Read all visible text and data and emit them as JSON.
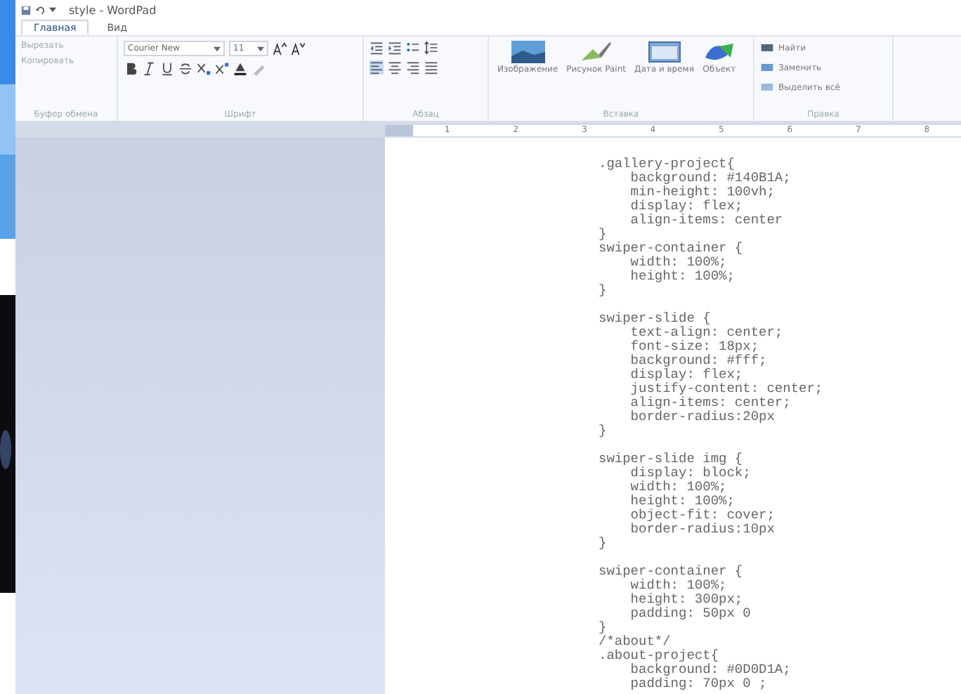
{
  "window": {
    "title": "style - WordPad"
  },
  "tabs": [
    {
      "label": "Главная",
      "selected": true
    },
    {
      "label": "Вид",
      "selected": false
    }
  ],
  "ribbon": {
    "clipboard": {
      "items": [
        "Вырезать",
        "Копировать"
      ],
      "label": "Буфер обмена"
    },
    "font": {
      "family": "Courier New",
      "size": "11",
      "label": "Шрифт"
    },
    "paragraph": {
      "label": "Абзац"
    },
    "insert": {
      "buttons": [
        "Изображение",
        "Рисунок Paint",
        "Дата и время",
        "Объект"
      ],
      "label": "Вставка"
    },
    "editing": {
      "items": [
        "Найти",
        "Заменить",
        "Выделить всё"
      ],
      "label": "Правка"
    }
  },
  "ruler": {
    "marks": [
      "1",
      "2",
      "3",
      "4",
      "5",
      "6",
      "7",
      "8"
    ]
  },
  "document": {
    "blocks": [
      {
        "lines": [
          ".gallery-project{",
          "    background: #140B1A;",
          "    min-height: 100vh;",
          "    display: flex;",
          "    align-items: center",
          "}",
          "swiper-container {",
          "    width: 100%;",
          "    height: 100%;",
          "}"
        ]
      },
      {
        "lines": [
          "swiper-slide {",
          "    text-align: center;",
          "    font-size: 18px;",
          "    background: #fff;",
          "    display: flex;",
          "    justify-content: center;",
          "    align-items: center;",
          "    border-radius:20px",
          "}"
        ]
      },
      {
        "lines": [
          "swiper-slide img {",
          "    display: block;",
          "    width: 100%;",
          "    height: 100%;",
          "    object-fit: cover;",
          "    border-radius:10px",
          "}"
        ]
      },
      {
        "lines": [
          "swiper-container {",
          "    width: 100%;",
          "    height: 300px;",
          "    padding: 50px 0",
          "}",
          "/*about*/",
          ".about-project{",
          "    background: #0D0D1A;",
          "    padding: 70px 0 ;"
        ]
      }
    ]
  }
}
